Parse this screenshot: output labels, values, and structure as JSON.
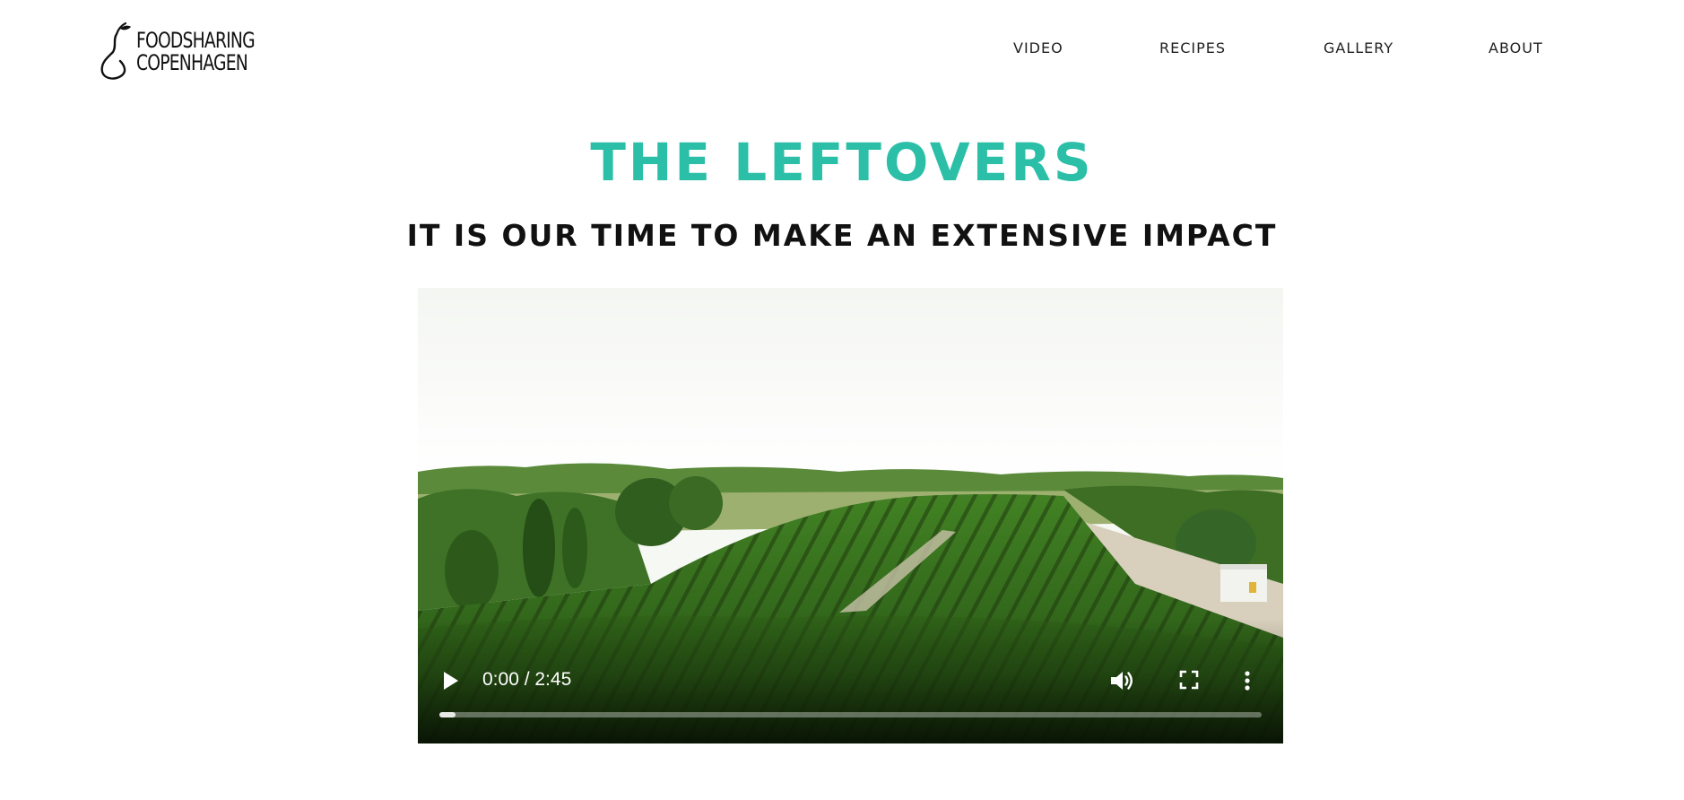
{
  "logo": {
    "line1": "FOODSHARING",
    "line2": "COPENHAGEN",
    "icon": "pear-icon"
  },
  "nav": {
    "items": [
      {
        "label": "VIDEO"
      },
      {
        "label": "RECIPES"
      },
      {
        "label": "GALLERY"
      },
      {
        "label": "ABOUT"
      }
    ]
  },
  "hero": {
    "title": "THE LEFTOVERS",
    "subtitle": "IT IS OUR TIME TO MAKE AN EXTENSIVE IMPACT"
  },
  "video": {
    "time_display": "0:00 / 2:45",
    "progress_fraction": 0.02,
    "controls": {
      "play_icon": "play-icon",
      "volume_icon": "volume-icon",
      "fullscreen_icon": "fullscreen-icon",
      "more_icon": "more-options-icon"
    }
  },
  "colors": {
    "accent": "#2bbfa8",
    "text": "#111111",
    "background": "#ffffff"
  }
}
